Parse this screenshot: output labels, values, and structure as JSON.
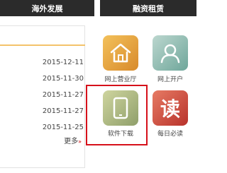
{
  "tabs": [
    "海外发展",
    "融资租赁"
  ],
  "news_dates": [
    "2015-12-11",
    "2015-11-30",
    "2015-11-27",
    "2015-11-27",
    "2015-11-25"
  ],
  "more_label": "更多",
  "more_arrow": "»",
  "tiles": [
    {
      "label": "网上营业厅",
      "icon": "house-icon"
    },
    {
      "label": "网上开户",
      "icon": "user-icon"
    },
    {
      "label": "软件下载",
      "icon": "tablet-icon"
    },
    {
      "label": "每日必读",
      "icon": "read-icon",
      "glyph": "读"
    }
  ],
  "colors": {
    "banner": "#2b2b2b",
    "accent_rule": "#f3c26a",
    "highlight": "#d6101a"
  }
}
